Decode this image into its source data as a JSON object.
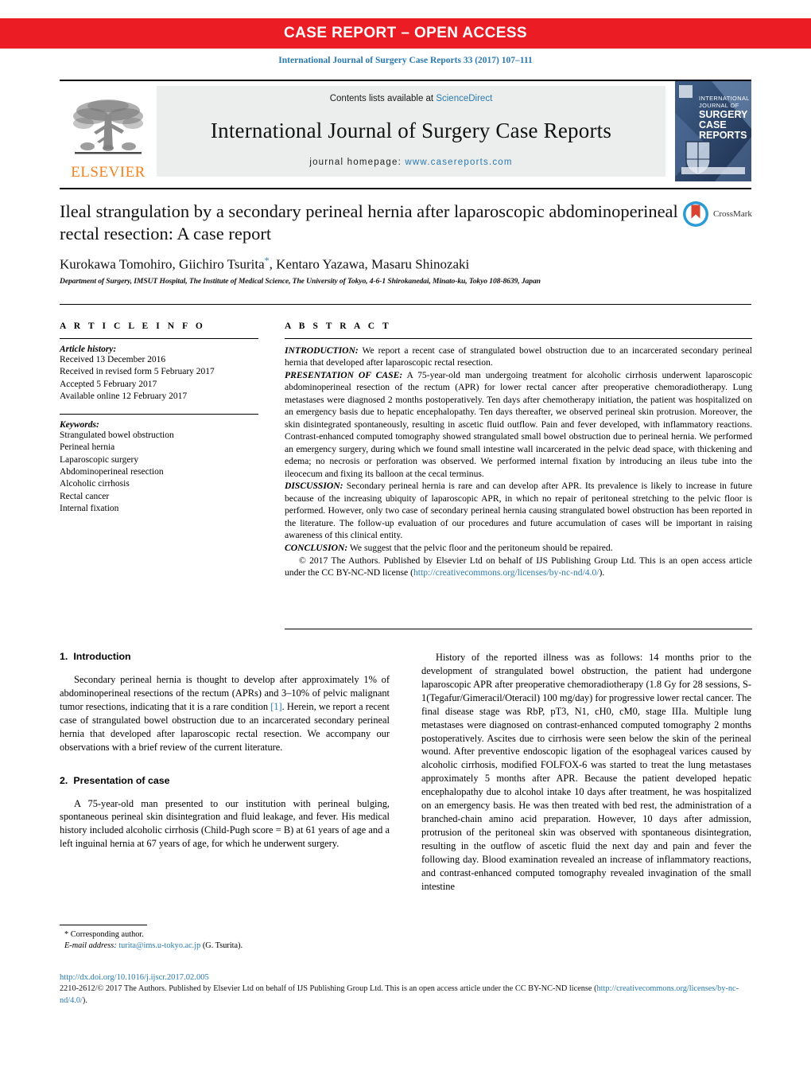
{
  "banner": {
    "label": "CASE REPORT – OPEN ACCESS"
  },
  "citation": {
    "text": "International Journal of Surgery Case Reports 33 (2017) 107–111"
  },
  "masthead": {
    "publisher_logo_label": "ELSEVIER",
    "contents_prefix": "Contents lists available at ",
    "contents_link": "ScienceDirect",
    "journal_name": "International Journal of Surgery Case Reports",
    "homepage_prefix": "journal homepage: ",
    "homepage_url": "www.casereports.com",
    "cover_lines": [
      "INTERNATIONAL",
      "JOURNAL OF",
      "SURGERY",
      "CASE",
      "REPORTS"
    ]
  },
  "article": {
    "title": "Ileal strangulation by a secondary perineal hernia after laparoscopic abdominoperineal rectal resection: A case report",
    "crossmark_label": "CrossMark",
    "authors": "Kurokawa Tomohiro, Giichiro Tsurita",
    "authors_tail": ", Kentaro Yazawa, Masaru Shinozaki",
    "affiliation": "Department of Surgery, IMSUT Hospital, The Institute of Medical Science, The University of Tokyo, 4-6-1 Shirokanedai, Minato-ku, Tokyo 108-8639, Japan"
  },
  "article_info": {
    "heading": "A R T I C L E   I N F O",
    "history_label": "Article history:",
    "history": [
      "Received 13 December 2016",
      "Received in revised form 5 February 2017",
      "Accepted 5 February 2017",
      "Available online 12 February 2017"
    ],
    "keywords_label": "Keywords:",
    "keywords": [
      "Strangulated bowel obstruction",
      "Perineal hernia",
      "Laparoscopic surgery",
      "Abdominoperineal resection",
      "Alcoholic cirrhosis",
      "Rectal cancer",
      "Internal fixation"
    ]
  },
  "abstract": {
    "heading": "A B S T R A C T",
    "sections": [
      {
        "label": "INTRODUCTION:",
        "text": " We report a recent case of strangulated bowel obstruction due to an incarcerated secondary perineal hernia that developed after laparoscopic rectal resection."
      },
      {
        "label": "PRESENTATION OF CASE:",
        "text": " A 75-year-old man undergoing treatment for alcoholic cirrhosis underwent laparoscopic abdominoperineal resection of the rectum (APR) for lower rectal cancer after preoperative chemoradiotherapy. Lung metastases were diagnosed 2 months postoperatively. Ten days after chemotherapy initiation, the patient was hospitalized on an emergency basis due to hepatic encephalopathy. Ten days thereafter, we observed perineal skin protrusion. Moreover, the skin disintegrated spontaneously, resulting in ascetic fluid outflow. Pain and fever developed, with inflammatory reactions. Contrast-enhanced computed tomography showed strangulated small bowel obstruction due to perineal hernia. We performed an emergency surgery, during which we found small intestine wall incarcerated in the pelvic dead space, with thickening and edema; no necrosis or perforation was observed. We performed internal fixation by introducing an ileus tube into the ileocecum and fixing its balloon at the cecal terminus."
      },
      {
        "label": "DISCUSSION:",
        "text": " Secondary perineal hernia is rare and can develop after APR. Its prevalence is likely to increase in future because of the increasing ubiquity of laparoscopic APR, in which no repair of peritoneal stretching to the pelvic floor is performed. However, only two case of secondary perineal hernia causing strangulated bowel obstruction has been reported in the literature. The follow-up evaluation of our procedures and future accumulation of cases will be important in raising awareness of this clinical entity."
      },
      {
        "label": "CONCLUSION:",
        "text": " We suggest that the pelvic floor and the peritoneum should be repaired."
      }
    ],
    "copyright_prefix": "© 2017 The Authors. Published by Elsevier Ltd on behalf of IJS Publishing Group Ltd. This is an open access article under the CC BY-NC-ND license (",
    "copyright_link": "http://creativecommons.org/licenses/by-nc-nd/4.0/",
    "copyright_suffix": ")."
  },
  "body": {
    "left": {
      "s1_num": "1.",
      "s1_title": "Introduction",
      "s1_p1_a": "Secondary perineal hernia is thought to develop after approximately 1% of abdominoperineal resections of the rectum (APRs) and 3–10% of pelvic malignant tumor resections, indicating that it is a rare condition ",
      "s1_p1_ref": "[1]",
      "s1_p1_b": ". Herein, we report a recent case of strangulated bowel obstruction due to an incarcerated secondary perineal hernia that developed after laparoscopic rectal resection. We accompany our observations with a brief review of the current literature.",
      "s2_num": "2.",
      "s2_title": "Presentation of case",
      "s2_p1": "A 75-year-old man presented to our institution with perineal bulging, spontaneous perineal skin disintegration and fluid leakage, and fever. His medical history included alcoholic cirrhosis (Child-Pugh score = B) at 61 years of age and a left inguinal hernia at 67 years of age, for which he underwent surgery."
    },
    "right": {
      "p1": "History of the reported illness was as follows: 14 months prior to the development of strangulated bowel obstruction, the patient had undergone laparoscopic APR after preoperative chemoradiotherapy (1.8 Gy for 28 sessions, S-1(Tegafur/Gimeracil/Oteracil) 100 mg/day) for progressive lower rectal cancer. The final disease stage was RbP, pT3, N1, cH0, cM0, stage IIIa. Multiple lung metastases were diagnosed on contrast-enhanced computed tomography 2 months postoperatively. Ascites due to cirrhosis were seen below the skin of the perineal wound. After preventive endoscopic ligation of the esophageal varices caused by alcoholic cirrhosis, modified FOLFOX-6 was started to treat the lung metastases approximately 5 months after APR. Because the patient developed hepatic encephalopathy due to alcohol intake 10 days after treatment, he was hospitalized on an emergency basis. He was then treated with bed rest, the administration of a branched-chain amino acid preparation. However, 10 days after admission, protrusion of the peritoneal skin was observed with spontaneous disintegration, resulting in the outflow of ascetic fluid the next day and pain and fever the following day. Blood examination revealed an increase of inflammatory reactions, and contrast-enhanced computed tomography revealed invagination of the small intestine"
    }
  },
  "footnote": {
    "corresponding": "* Corresponding author.",
    "email_label": "E-mail address:",
    "email": "turita@ims.u-tokyo.ac.jp",
    "email_attrib": "(G. Tsurita)."
  },
  "license_block": {
    "doi": "http://dx.doi.org/10.1016/j.ijscr.2017.02.005",
    "prefix": "2210-2612/© 2017 The Authors. Published by Elsevier Ltd on behalf of IJS Publishing Group Ltd. This is an open access article under the CC BY-NC-ND license (",
    "link": "http://creativecommons.org/licenses/by-nc-nd/4.0/",
    "suffix": ")."
  },
  "colors": {
    "banner_red": "#ec1c24",
    "link_blue": "#2a7ab0",
    "elsevier_orange": "#f58220",
    "masthead_grey": "#eceded"
  }
}
